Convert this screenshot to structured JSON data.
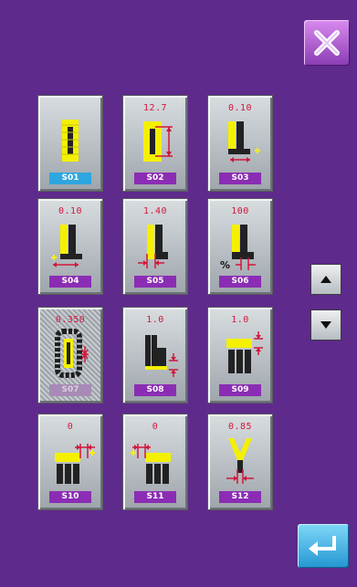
{
  "top": {
    "close_icon": "close-x-icon",
    "accent": "#bf6be6"
  },
  "patterns": [
    {
      "code": "S01",
      "value": "",
      "selected_code_color": "blue",
      "icon": "rectangle-stitch-icon"
    },
    {
      "code": "S02",
      "value": "12.7",
      "icon": "rectangle-width-icon"
    },
    {
      "code": "S03",
      "value": "0.10",
      "icon": "offset-corner-icon"
    },
    {
      "code": "S04",
      "value": "0.10",
      "icon": "offset-left-icon"
    },
    {
      "code": "S05",
      "value": "1.40",
      "icon": "spacing-icon"
    },
    {
      "code": "S06",
      "value": "100",
      "icon": "percent-icon"
    },
    {
      "code": "S07",
      "value": "0.350",
      "icon": "chain-stitch-icon",
      "selected": true
    },
    {
      "code": "S08",
      "value": "1.0",
      "icon": "height-icon"
    },
    {
      "code": "S09",
      "value": "1.0",
      "icon": "bar-height-icon"
    },
    {
      "code": "S10",
      "value": "0",
      "icon": "bar-right-offset-icon"
    },
    {
      "code": "S11",
      "value": "0",
      "icon": "bar-left-offset-icon"
    },
    {
      "code": "S12",
      "value": "0.85",
      "icon": "y-shape-icon"
    }
  ],
  "nav": {
    "up_icon": "up-arrow-icon",
    "down_icon": "down-arrow-icon",
    "enter_icon": "enter-return-icon"
  }
}
